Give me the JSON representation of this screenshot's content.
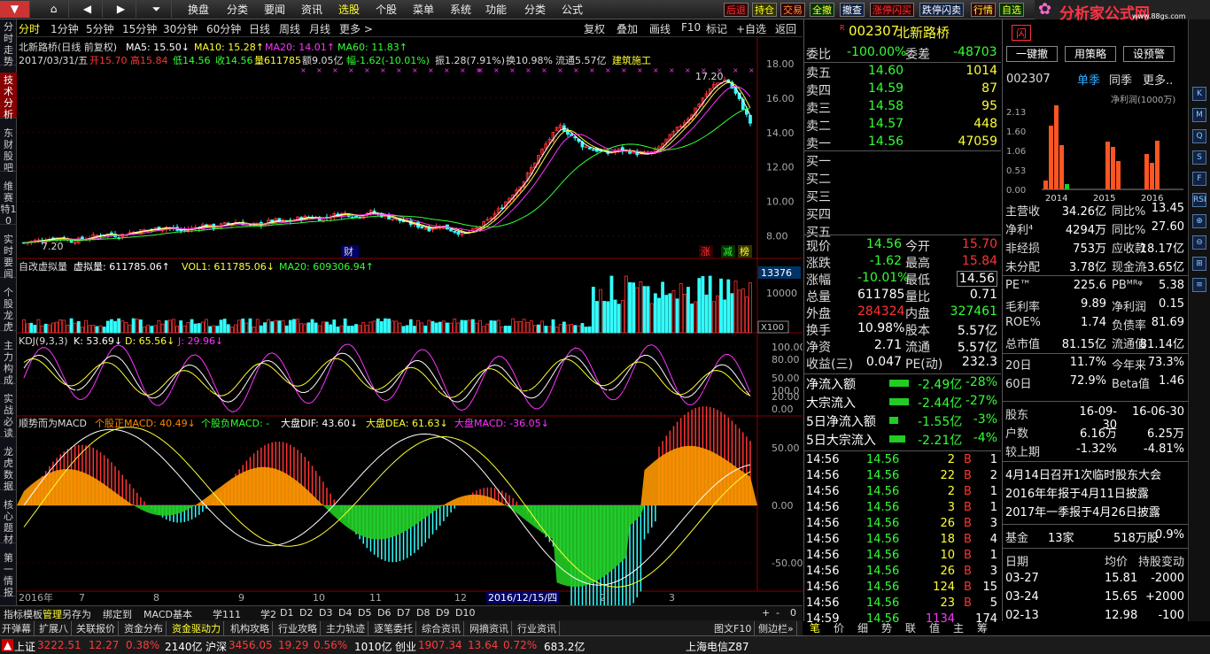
{
  "menu": {
    "nav_icons": [
      "home-icon",
      "back-icon",
      "forward-icon",
      "expand-icon"
    ],
    "items": [
      "换盘",
      "分类",
      "要闻",
      "资讯",
      "选股",
      "个股",
      "菜单",
      "系统",
      "功能",
      "分类",
      "公式"
    ],
    "selected": "选股",
    "quick": [
      "后退",
      "持仓",
      "交易",
      "全撤",
      "撤查",
      "涨停闪买",
      "跌停闪卖",
      "行情",
      "自选"
    ],
    "logo": "分析家公式网",
    "logo_url": "www.88gs.com"
  },
  "leftnav": [
    "分时走势",
    "技术分析",
    "东财股吧",
    "维赛特10",
    "实时要闻",
    "个股龙虎",
    "主力构成",
    "实战必读",
    "龙虎数据",
    "核心题材",
    "第一情报"
  ],
  "leftnav_selected": "技术分析",
  "periods": {
    "items": [
      "分时",
      "1分钟",
      "5分钟",
      "15分钟",
      "30分钟",
      "60分钟",
      "日线",
      "周线",
      "月线",
      "更多 >"
    ],
    "selected": "分时"
  },
  "chart_buttons": [
    "复权",
    "叠加",
    "画线",
    "F10",
    "标记",
    "+自选",
    "返回"
  ],
  "header": {
    "line1_name": "北新路桥(日线 前复权)",
    "ma5": "MA5: 15.50↓",
    "ma10": "MA10: 15.28↑",
    "ma20": "MA20: 14.01↑",
    "ma60": "MA60: 11.83↑",
    "line2_date": "2017/03/31/五",
    "open": "开15.70",
    "high": "高15.84",
    "low": "低14.56",
    "close": "收14.56",
    "vol": "量611785",
    "amt": "额9.05亿",
    "chg": "幅-1.62(-10.01%)",
    "amp": "振1.28(7.91%)",
    "turn": "换10.98%",
    "float": "流通5.57亿",
    "sector": "建筑施工"
  },
  "price_axis": [
    "18.00",
    "16.00",
    "14.00",
    "12.00",
    "10.00",
    "8.00"
  ],
  "price_labels": {
    "high": "17.20",
    "low": "7.20",
    "cai": "财",
    "zhang": "涨",
    "jian": "减",
    "bang": "榜"
  },
  "vol_header": {
    "title": "自改虚拟量",
    "virt": "虚拟量: 611785.06↑",
    "vol1": "VOL1: 611785.06↓",
    "ma20": "MA20: 609306.94↑"
  },
  "vol_axis": {
    "top": "13376",
    "mid": "10000",
    "unit": "X100"
  },
  "kdj_header": {
    "title": "KDJ(9,3,3)",
    "k": "K: 53.69↓",
    "d": "D: 65.56↓",
    "j": "J: 29.96↓"
  },
  "kdj_axis": [
    "100.00",
    "80.00",
    "50.00",
    "20.00",
    "0.00"
  ],
  "macd_header": {
    "title": "顺势而为MACD",
    "gm": "个股正MACD: 40.49↓",
    "gf": "个股负MACD: -",
    "dif": "大盘DIF: 43.60↓",
    "dea": "大盘DEA: 61.63↓",
    "macd": "大盘MACD: -36.05↓"
  },
  "macd_axis": [
    "100.0",
    "50.00",
    "0.00",
    "-50.00"
  ],
  "time_axis": {
    "labels": [
      "2016年",
      "7",
      "8",
      "9",
      "10",
      "11",
      "12",
      "2",
      "3"
    ],
    "cursor": "2016/12/15/四"
  },
  "bottom_tabs": [
    "指标",
    "模板",
    "管理",
    "另存为",
    "绑定到",
    "MACD基本",
    "学111",
    "学2",
    "D1",
    "D2",
    "D3",
    "D4",
    "D5",
    "D6",
    "D7",
    "D8",
    "D9",
    "D10"
  ],
  "bottom_tab_selected": "管理",
  "bottom_tools": [
    "+",
    "-",
    "0"
  ],
  "feature_tabs": [
    "开弹幕",
    "扩展八",
    "关联报价",
    "资金分布",
    "资金驱动力",
    "机构攻略",
    "行业攻略",
    "主力轨迹",
    "逐笔委托",
    "综合资讯",
    "网摘资讯",
    "行业资讯"
  ],
  "feature_selected": "资金驱动力",
  "feature_right": [
    "图文F10",
    "侧边栏»"
  ],
  "quote": {
    "code": "002307",
    "name": "北新路桥",
    "ratio_label": "委比",
    "ratio": "-100.00%",
    "diff_label": "委差",
    "diff": "-48703",
    "asks": [
      {
        "l": "卖五",
        "p": "14.60",
        "v": "1014"
      },
      {
        "l": "卖四",
        "p": "14.59",
        "v": "87"
      },
      {
        "l": "卖三",
        "p": "14.58",
        "v": "95"
      },
      {
        "l": "卖二",
        "p": "14.57",
        "v": "448"
      },
      {
        "l": "卖一",
        "p": "14.56",
        "v": "47059"
      }
    ],
    "bids": [
      "买一",
      "买二",
      "买三",
      "买四",
      "买五"
    ],
    "stats": [
      [
        "现价",
        "14.56",
        "今开",
        "15.70"
      ],
      [
        "涨跌",
        "-1.62",
        "最高",
        "15.84"
      ],
      [
        "涨幅",
        "-10.01%",
        "最低",
        "14.56"
      ],
      [
        "总量",
        "611785",
        "量比",
        "0.71"
      ],
      [
        "外盘",
        "284324",
        "内盘",
        "327461"
      ],
      [
        "换手",
        "10.98%",
        "股本",
        "5.57亿"
      ],
      [
        "净资",
        "2.71",
        "流通",
        "5.57亿"
      ],
      [
        "收益(三)",
        "0.047",
        "PE(动)",
        "232.3"
      ]
    ],
    "flows": [
      [
        "净流入额",
        "-2.49亿",
        "-28%"
      ],
      [
        "大宗流入",
        "-2.44亿",
        "-27%"
      ],
      [
        "5日净流入额",
        "-1.55亿",
        "-3%"
      ],
      [
        "5日大宗流入",
        "-2.21亿",
        "-4%"
      ]
    ],
    "ticks": [
      [
        "14:56",
        "14.56",
        "2",
        "B",
        "1"
      ],
      [
        "14:56",
        "14.56",
        "22",
        "B",
        "2"
      ],
      [
        "14:56",
        "14.56",
        "2",
        "B",
        "1"
      ],
      [
        "14:56",
        "14.56",
        "3",
        "B",
        "1"
      ],
      [
        "14:56",
        "14.56",
        "26",
        "B",
        "3"
      ],
      [
        "14:56",
        "14.56",
        "18",
        "B",
        "4"
      ],
      [
        "14:56",
        "14.56",
        "10",
        "B",
        "1"
      ],
      [
        "14:56",
        "14.56",
        "26",
        "B",
        "3"
      ],
      [
        "14:56",
        "14.56",
        "124",
        "B",
        "15"
      ],
      [
        "14:56",
        "14.56",
        "23",
        "B",
        "5"
      ],
      [
        "14:59",
        "14.56",
        "1134",
        "",
        "174"
      ]
    ],
    "tabs": [
      "笔",
      "价",
      "细",
      "势",
      "联",
      "值",
      "主",
      "筹"
    ]
  },
  "info": {
    "flash": "闪",
    "buttons": [
      "一键撤",
      "用策略",
      "设预警"
    ],
    "code": "002307",
    "season": "单季",
    "same": "同季",
    "more": "更多..",
    "chart_title": "净利润(1000万)",
    "y_ticks": [
      "2.13",
      "1.60",
      "1.06",
      "0.53",
      "0.00"
    ],
    "years": [
      "2014",
      "2015",
      "2016"
    ],
    "fin": [
      [
        "主营收",
        "34.26亿",
        "同比%",
        "13.45"
      ],
      [
        "净利⁴",
        "4294万",
        "同比%",
        "27.60"
      ],
      [
        "非经损",
        "753万",
        "应收款",
        "18.17亿"
      ],
      [
        "未分配",
        "3.78亿",
        "现金流",
        "-3.65亿"
      ],
      [
        "PE™",
        "225.6",
        "PBᴹᴿᵠ",
        "5.38"
      ],
      [
        "毛利率",
        "9.89",
        "净利润",
        "0.15"
      ],
      [
        "ROE%",
        "1.74",
        "负债率",
        "81.69"
      ],
      [
        "总市值",
        "81.15亿",
        "流通值",
        "81.14亿"
      ],
      [
        "20日",
        "11.7%",
        "今年来",
        "73.3%"
      ],
      [
        "60日",
        "72.9%",
        "Beta值",
        "1.46"
      ]
    ],
    "holders": [
      [
        "股东",
        "16-09-30",
        "16-06-30"
      ],
      [
        "户数",
        "6.16万",
        "6.25万"
      ],
      [
        "较上期",
        "-1.32%",
        "-4.81%"
      ]
    ],
    "news": [
      "4月14日召开1次临时股东大会",
      "2016年年报于4月11日披露",
      "2017年一季报于4月26日披露"
    ],
    "fund": [
      "基金",
      "13家",
      "518万股",
      "0.9%"
    ],
    "trade_head": [
      "日期",
      "均价",
      "持股变动"
    ],
    "trades": [
      [
        "03-27",
        "15.81",
        "-2000"
      ],
      [
        "03-24",
        "15.65",
        "+2000"
      ],
      [
        "02-13",
        "12.98",
        "-100"
      ]
    ]
  },
  "right_icons": [
    "K",
    "M",
    "Q",
    "S",
    "F",
    "RSI",
    "⊕",
    "⊖",
    "⊞",
    "≡"
  ],
  "status": {
    "sh_label": "上证",
    "sh": "3222.51",
    "sh_chg": "12.27",
    "sh_pct": "0.38%",
    "sh_amt": "2140亿",
    "hs_label": "沪深",
    "hs": "3456.05",
    "hs_chg": "19.29",
    "hs_pct": "0.56%",
    "hs_amt": "1010亿",
    "cy_label": "创业",
    "cy": "1907.34",
    "cy_chg": "13.64",
    "cy_pct": "0.72%",
    "cy_amt": "683.2亿",
    "server": "上海电信Z87"
  },
  "chart_data": {
    "type": "candlestick",
    "note_series": "price closes approximate",
    "closes": [
      7.6,
      7.7,
      7.8,
      7.9,
      7.7,
      7.8,
      8.0,
      8.1,
      8.0,
      8.2,
      8.3,
      8.4,
      8.5,
      8.3,
      8.4,
      8.6,
      8.5,
      8.7,
      8.8,
      8.6,
      8.7,
      8.9,
      8.8,
      9.0,
      9.1,
      9.0,
      9.2,
      9.3,
      9.1,
      9.4,
      9.2,
      9.0,
      8.8,
      8.6,
      8.4,
      8.6,
      8.3,
      8.1,
      8.4,
      8.9,
      9.6,
      10.4,
      11.2,
      12.4,
      13.5,
      14.4,
      13.8,
      13.2,
      13.0,
      12.8,
      13.0,
      12.9,
      12.7,
      12.9,
      13.6,
      14.3,
      15.0,
      16.0,
      16.8,
      17.1,
      16.0,
      14.56
    ],
    "ylim": [
      7.2,
      18.0
    ]
  }
}
